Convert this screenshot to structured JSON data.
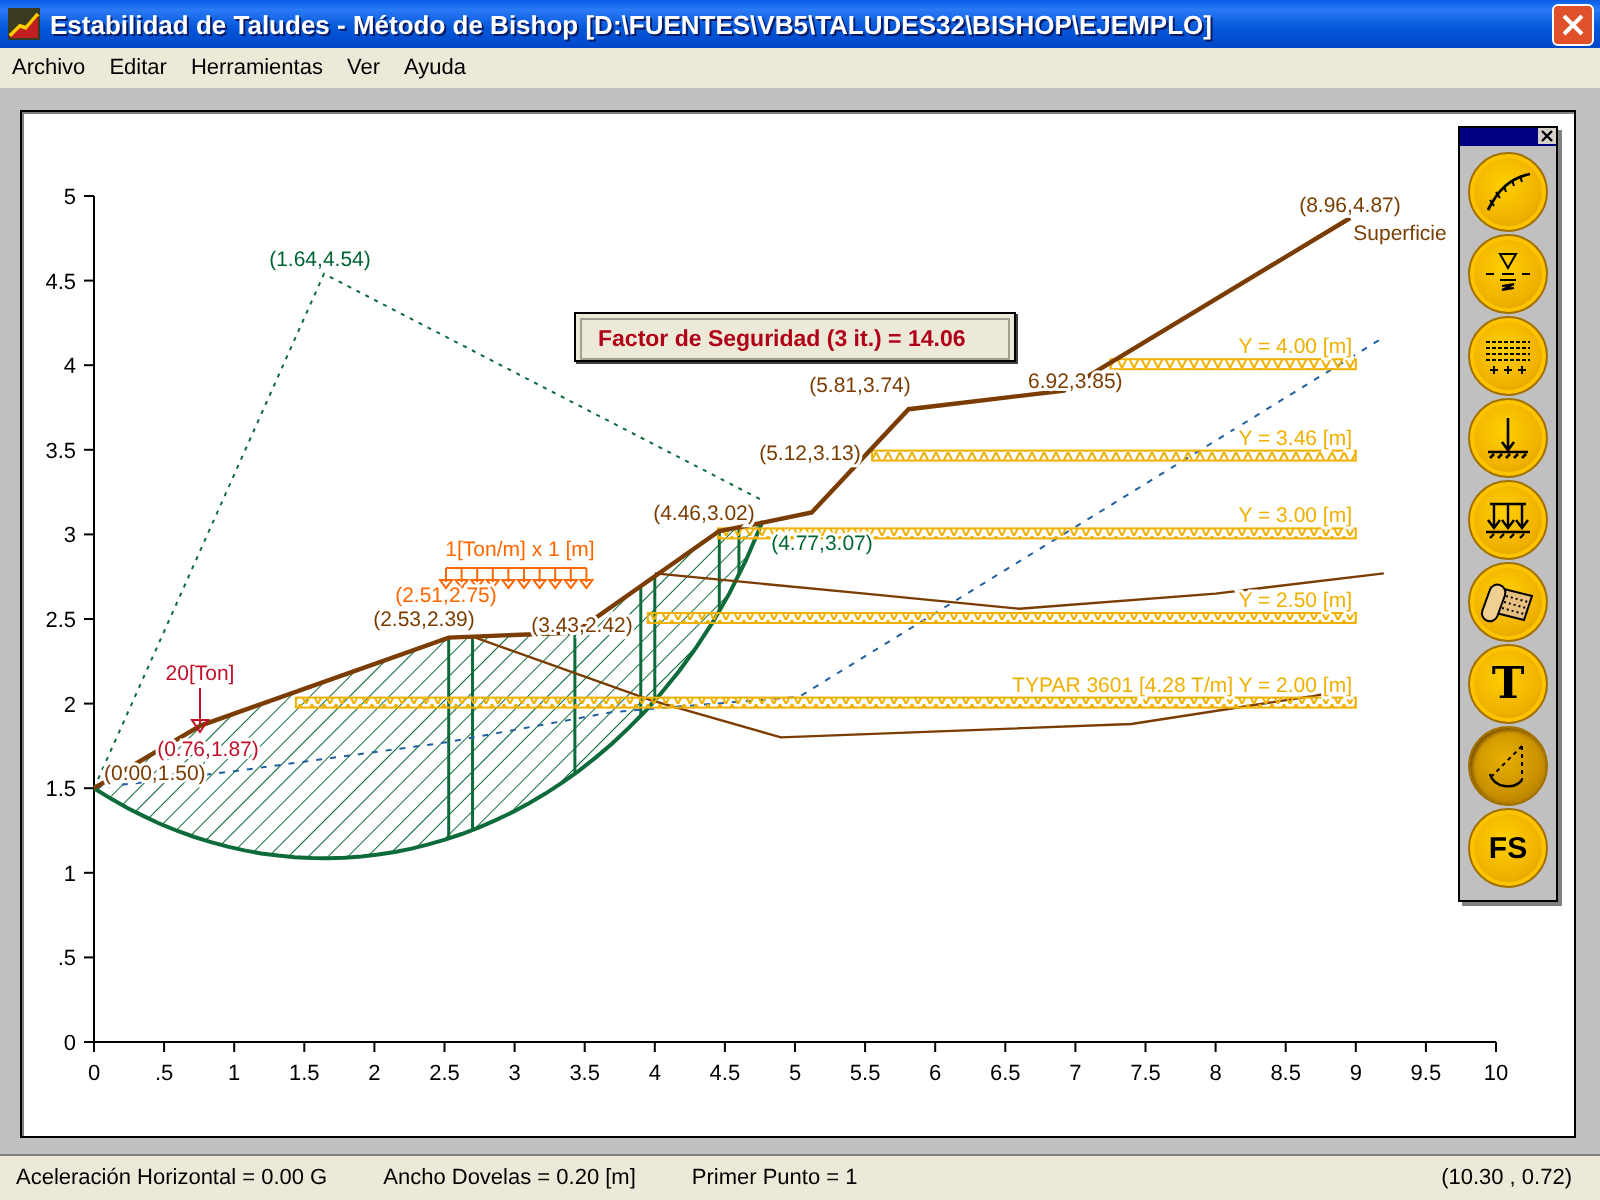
{
  "window": {
    "title": "Estabilidad de Taludes - Método de Bishop [D:\\FUENTES\\VB5\\TALUDES32\\BISHOP\\EJEMPLO]"
  },
  "menu": [
    "Archivo",
    "Editar",
    "Herramientas",
    "Ver",
    "Ayuda"
  ],
  "plot": {
    "x_ticks": [
      "0",
      ".5",
      "1",
      "1.5",
      "2",
      "2.5",
      "3",
      "3.5",
      "4",
      "4.5",
      "5",
      "5.5",
      "6",
      "6.5",
      "7",
      "7.5",
      "8",
      "8.5",
      "9",
      "9.5",
      "10"
    ],
    "y_ticks": [
      "5",
      "4.5",
      "4",
      "3.5",
      "3",
      "2.5",
      "2",
      "1.5",
      "1",
      ".5",
      "0"
    ],
    "point_labels": [
      {
        "text": "(1.64,4.54)",
        "kind": "circle"
      },
      {
        "text": "(8.96,4.87)",
        "kind": "surface"
      },
      {
        "text": "Superficie",
        "kind": "surface"
      },
      {
        "text": "(5.81,3.74)",
        "kind": "surface"
      },
      {
        "text": "6.92,3.85)",
        "kind": "surface"
      },
      {
        "text": "(5.12,3.13)",
        "kind": "surface"
      },
      {
        "text": "(4.46,3.02)",
        "kind": "surface"
      },
      {
        "text": "(4.77,3.07)",
        "kind": "circle"
      },
      {
        "text": "(2.51,2.75)",
        "kind": "load"
      },
      {
        "text": "(2.53,2.39)",
        "kind": "surface"
      },
      {
        "text": "(3.43,2.42)",
        "kind": "surface"
      },
      {
        "text": "(0.76,1.87)",
        "kind": "point_load"
      },
      {
        "text": "(0.00,1.50)",
        "kind": "surface"
      }
    ],
    "loads": [
      {
        "kind": "distributed",
        "label": "1[Ton/m] x 1 [m]"
      },
      {
        "kind": "point",
        "label": "20[Ton]"
      }
    ],
    "reinforcements": [
      {
        "label": "Y = 4.00 [m]"
      },
      {
        "label": "Y = 3.46 [m]"
      },
      {
        "label": "Y = 3.00 [m]"
      },
      {
        "label": "Y = 2.50 [m]"
      },
      {
        "label": "TYPAR 3601 [4.28 T/m] Y = 2.00 [m]"
      }
    ],
    "factor_of_safety": "Factor de Seguridad (3 it.) = 14.06"
  },
  "toolbar": {
    "buttons": [
      {
        "kind": "surface",
        "selected": false
      },
      {
        "kind": "water",
        "selected": false
      },
      {
        "kind": "layers",
        "selected": false
      },
      {
        "kind": "point_load",
        "selected": false
      },
      {
        "kind": "distributed_load",
        "selected": false
      },
      {
        "kind": "geotextile",
        "selected": false
      },
      {
        "kind": "text",
        "label": "T",
        "selected": false
      },
      {
        "kind": "circle",
        "selected": true
      },
      {
        "kind": "text",
        "label": "FS",
        "selected": false
      }
    ]
  },
  "status_bar": [
    "Aceleración Horizontal = 0.00 G",
    "Ancho Dovelas = 0.20 [m]",
    "Primer Punto = 1",
    "(10.30 , 0.72)"
  ]
}
